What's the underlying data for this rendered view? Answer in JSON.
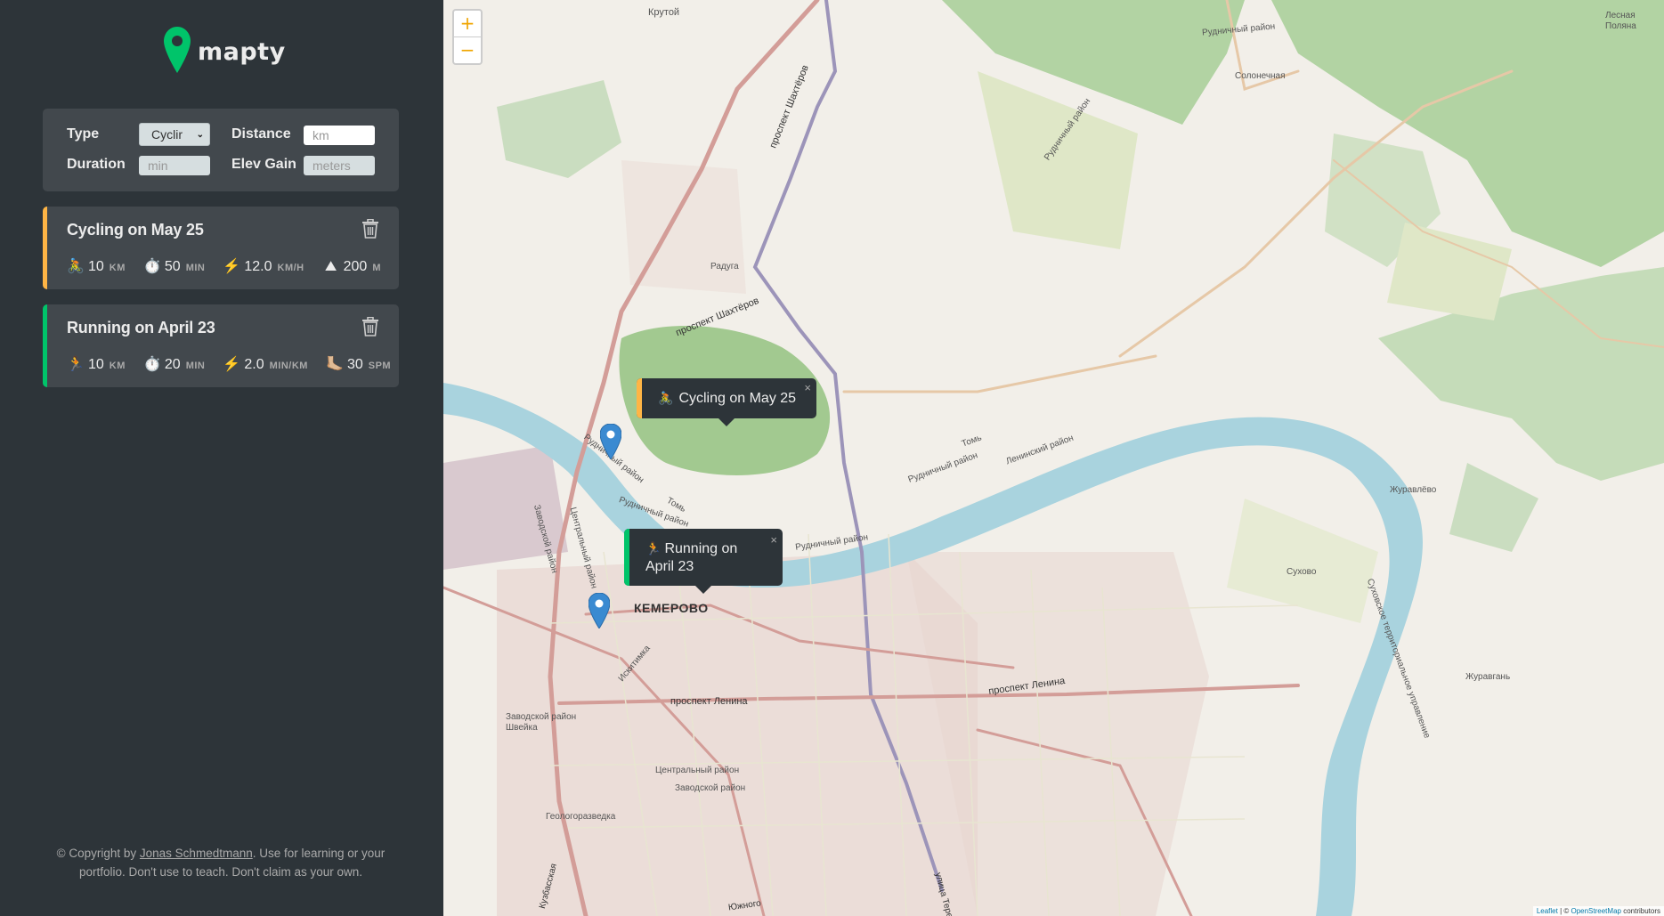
{
  "app": {
    "name": "mapty"
  },
  "colors": {
    "cycling": "#ffb545",
    "running": "#00c46a",
    "accent": "#f0a500",
    "sidebar": "#2d3439",
    "card": "#42484d"
  },
  "form": {
    "type_label": "Type",
    "type_value": "Cyclir",
    "distance_label": "Distance",
    "distance_placeholder": "km",
    "duration_label": "Duration",
    "duration_placeholder": "min",
    "elev_label": "Elev Gain",
    "elev_placeholder": "meters"
  },
  "workouts": [
    {
      "title": "Cycling on May 25",
      "type": "cycling",
      "details": [
        {
          "icon": "bicycle-icon",
          "value": "10",
          "unit": "km"
        },
        {
          "icon": "stopwatch-icon",
          "value": "50",
          "unit": "min"
        },
        {
          "icon": "lightning-icon",
          "value": "12.0",
          "unit": "km/h"
        },
        {
          "icon": "mountain-icon",
          "value": "200",
          "unit": "m"
        }
      ]
    },
    {
      "title": "Running on April 23",
      "type": "running",
      "details": [
        {
          "icon": "runner-icon",
          "value": "10",
          "unit": "km"
        },
        {
          "icon": "stopwatch-icon",
          "value": "20",
          "unit": "min"
        },
        {
          "icon": "lightning-icon",
          "value": "2.0",
          "unit": "min/km"
        },
        {
          "icon": "footprint-icon",
          "value": "30",
          "unit": "spm"
        }
      ]
    }
  ],
  "copyright": {
    "prefix": "© Copyright by ",
    "author": "Jonas Schmedtmann",
    "suffix": ". Use for learning or your portfolio. Don't use to teach. Don't claim as your own."
  },
  "map": {
    "zoom_in": "+",
    "zoom_out": "−",
    "popups": [
      {
        "emoji": "🚴",
        "label": "Cycling on May 25",
        "close": "×"
      },
      {
        "emoji": "🏃",
        "label": "Running on April 23",
        "close": "×"
      }
    ],
    "labels": {
      "city": "КЕМЕРОВО",
      "krutoy": "Крутой",
      "lesnaya": "Лесная Поляна",
      "rudnichny1": "Рудничный район",
      "rudnichny2": "Рудничный район",
      "rudnichny3": "Рудничный район",
      "rudnichny4": "Рудничный район",
      "rudnichny5": "Рудничный район",
      "rudnichny6": "Рудничный район",
      "solonechnaya": "Солонечная",
      "prospekt_shakhterov": "проспект Шахтёров",
      "prospekt_shakhterov2": "проспект Шахтёров",
      "raduga": "Радуга",
      "leninsky": "Ленинский район",
      "tom1": "Томь",
      "tom2": "Томь",
      "zavodskoy": "Заводской район",
      "tsentralny": "Центральный район",
      "zhuravlevo": "Журавлёво",
      "sukhovo": "Сухово",
      "zhuravgan": "Журавгань",
      "sukhovskoe": "Суховское территориальное управление",
      "prospekt_lenina1": "проспект Ленина",
      "prospekt_lenina2": "проспект Ленина",
      "zavodskoy_shvejka": "Заводской район Швейка",
      "tsentralny2": "Центральный район",
      "zavodskoy2": "Заводской район",
      "geologorazvedka": "Геологоразведка",
      "iskitimka": "Искитимка",
      "ulitsa_tereshkovoy": "улица Терешковой",
      "tsentralny_left": "Центральный район",
      "zavodskoy_left": "Заводской район",
      "zhilnogo": "Южного",
      "kuzbasskaya": "Кузбасская"
    },
    "attribution": {
      "leaflet": "Leaflet",
      "sep": " | © ",
      "osm": "OpenStreetMap",
      "suffix": " contributors"
    }
  }
}
